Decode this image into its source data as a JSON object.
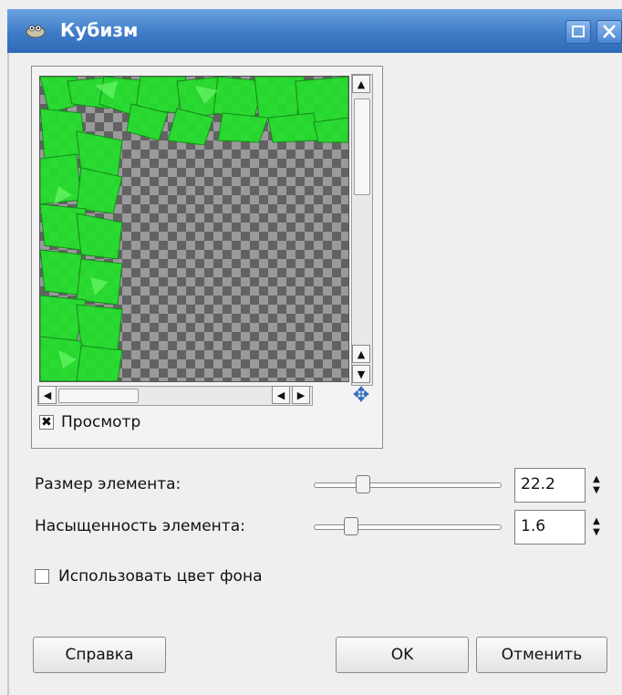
{
  "window": {
    "title": "Кубизм",
    "title_bar_color": "#3f7cc8"
  },
  "preview": {
    "checkbox_label": "Просмотр",
    "checked": true,
    "checked_glyph": "✖"
  },
  "settings": {
    "tile_size": {
      "label": "Размер элемента:",
      "value": "22.2",
      "slider_fraction": 0.26
    },
    "tile_saturation": {
      "label": "Насыщенность элемента:",
      "value": "1.6",
      "slider_fraction": 0.2
    }
  },
  "background_option": {
    "label": "Использовать цвет фона",
    "checked": false
  },
  "buttons": {
    "help": "Справка",
    "ok": "OK",
    "cancel": "Отменить"
  },
  "icons": {
    "app": "wilber-icon",
    "maximize": "maximize-icon",
    "close": "close-icon",
    "navigate": "navigate-icon"
  },
  "colors": {
    "accent_green": "#22e02a",
    "checker_dark": "#626262",
    "checker_light": "#9a9a9a"
  }
}
